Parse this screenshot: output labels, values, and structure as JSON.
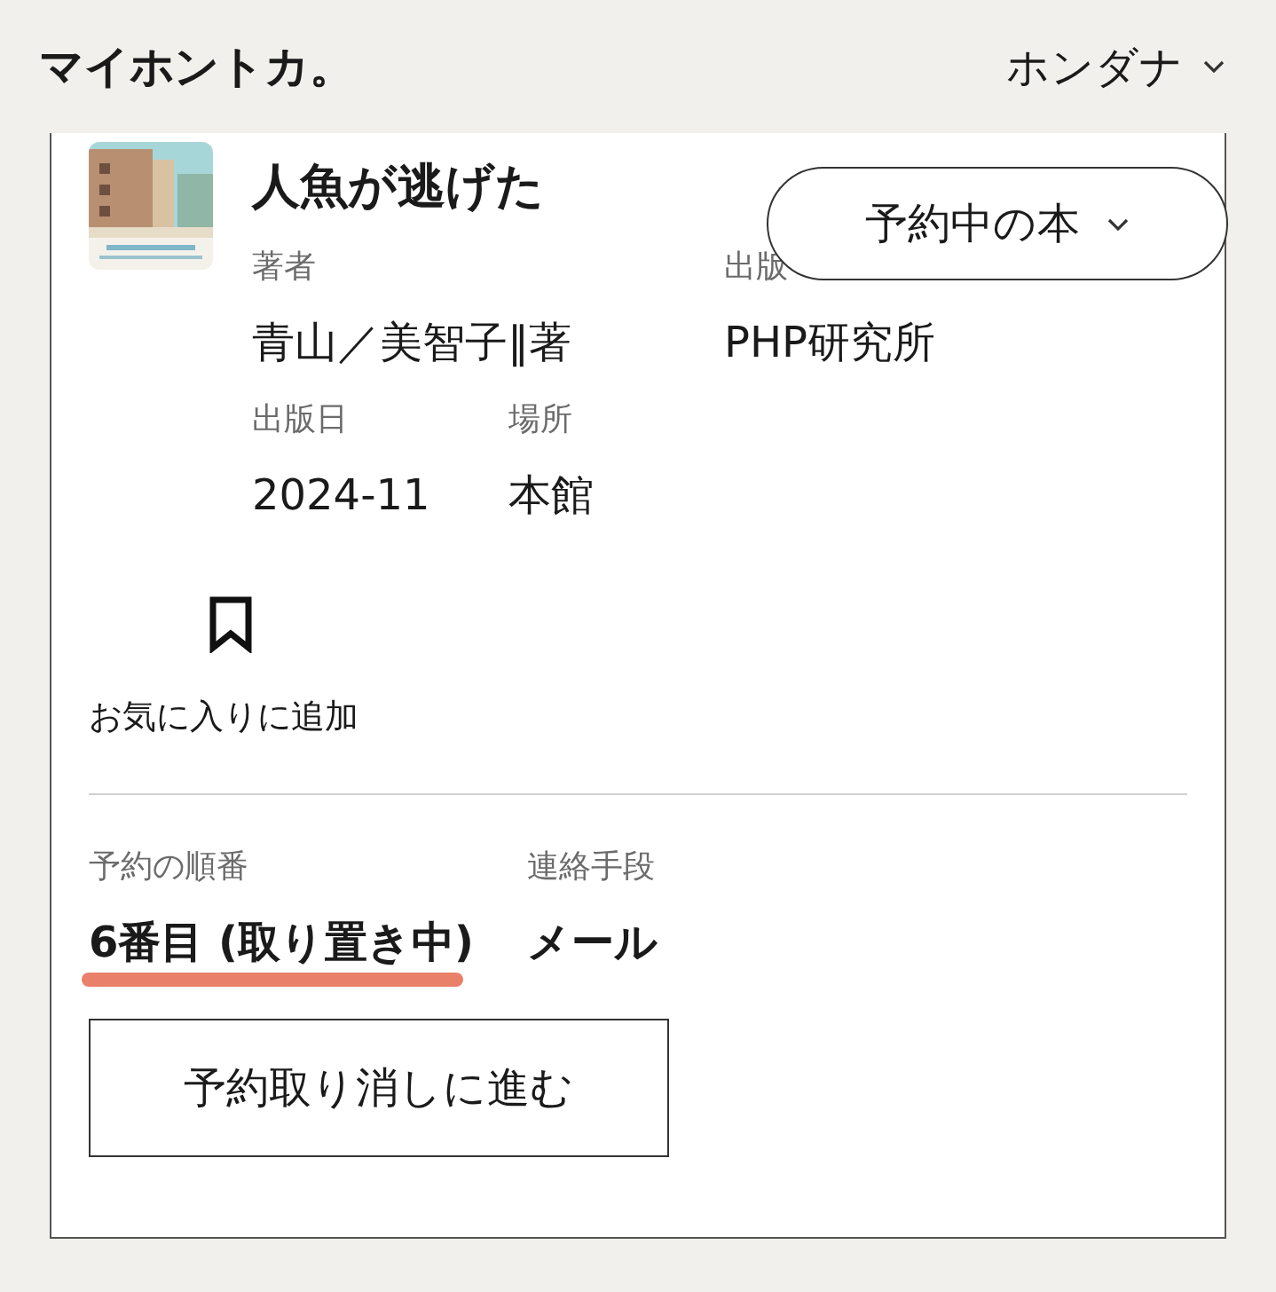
{
  "header": {
    "logo": "マイホントカ。",
    "menu": "ホンダナ"
  },
  "book": {
    "title": "人魚が逃げた",
    "fields": [
      {
        "label": "著者",
        "value": "青山／美智子‖著"
      },
      {
        "label": "出版",
        "value": "PHP研究所"
      },
      {
        "label": "出版日",
        "value": "2024-11"
      },
      {
        "label": "場所",
        "value": "本館"
      }
    ],
    "status_dropdown": "予約中の本",
    "favorite": "お気に入りに追加"
  },
  "reservation": {
    "fields": [
      {
        "label": "予約の順番",
        "value": "6番目 (取り置き中)",
        "highlighted": true
      },
      {
        "label": "連絡手段",
        "value": "メール",
        "highlighted": false
      }
    ],
    "cancel_button": "予約取り消しに進む"
  }
}
